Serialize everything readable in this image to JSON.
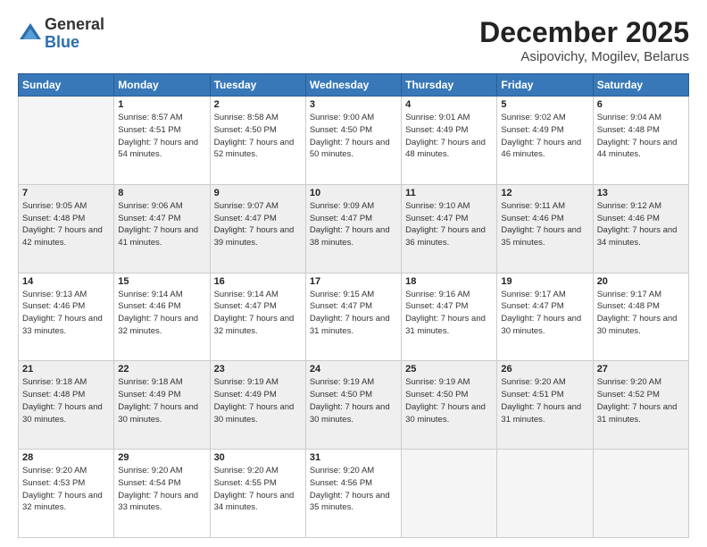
{
  "logo": {
    "general": "General",
    "blue": "Blue"
  },
  "header": {
    "month": "December 2025",
    "location": "Asipovichy, Mogilev, Belarus"
  },
  "weekdays": [
    "Sunday",
    "Monday",
    "Tuesday",
    "Wednesday",
    "Thursday",
    "Friday",
    "Saturday"
  ],
  "weeks": [
    [
      {
        "day": "",
        "empty": true
      },
      {
        "day": "1",
        "sunrise": "Sunrise: 8:57 AM",
        "sunset": "Sunset: 4:51 PM",
        "daylight": "Daylight: 7 hours and 54 minutes."
      },
      {
        "day": "2",
        "sunrise": "Sunrise: 8:58 AM",
        "sunset": "Sunset: 4:50 PM",
        "daylight": "Daylight: 7 hours and 52 minutes."
      },
      {
        "day": "3",
        "sunrise": "Sunrise: 9:00 AM",
        "sunset": "Sunset: 4:50 PM",
        "daylight": "Daylight: 7 hours and 50 minutes."
      },
      {
        "day": "4",
        "sunrise": "Sunrise: 9:01 AM",
        "sunset": "Sunset: 4:49 PM",
        "daylight": "Daylight: 7 hours and 48 minutes."
      },
      {
        "day": "5",
        "sunrise": "Sunrise: 9:02 AM",
        "sunset": "Sunset: 4:49 PM",
        "daylight": "Daylight: 7 hours and 46 minutes."
      },
      {
        "day": "6",
        "sunrise": "Sunrise: 9:04 AM",
        "sunset": "Sunset: 4:48 PM",
        "daylight": "Daylight: 7 hours and 44 minutes."
      }
    ],
    [
      {
        "day": "7",
        "sunrise": "Sunrise: 9:05 AM",
        "sunset": "Sunset: 4:48 PM",
        "daylight": "Daylight: 7 hours and 42 minutes."
      },
      {
        "day": "8",
        "sunrise": "Sunrise: 9:06 AM",
        "sunset": "Sunset: 4:47 PM",
        "daylight": "Daylight: 7 hours and 41 minutes."
      },
      {
        "day": "9",
        "sunrise": "Sunrise: 9:07 AM",
        "sunset": "Sunset: 4:47 PM",
        "daylight": "Daylight: 7 hours and 39 minutes."
      },
      {
        "day": "10",
        "sunrise": "Sunrise: 9:09 AM",
        "sunset": "Sunset: 4:47 PM",
        "daylight": "Daylight: 7 hours and 38 minutes."
      },
      {
        "day": "11",
        "sunrise": "Sunrise: 9:10 AM",
        "sunset": "Sunset: 4:47 PM",
        "daylight": "Daylight: 7 hours and 36 minutes."
      },
      {
        "day": "12",
        "sunrise": "Sunrise: 9:11 AM",
        "sunset": "Sunset: 4:46 PM",
        "daylight": "Daylight: 7 hours and 35 minutes."
      },
      {
        "day": "13",
        "sunrise": "Sunrise: 9:12 AM",
        "sunset": "Sunset: 4:46 PM",
        "daylight": "Daylight: 7 hours and 34 minutes."
      }
    ],
    [
      {
        "day": "14",
        "sunrise": "Sunrise: 9:13 AM",
        "sunset": "Sunset: 4:46 PM",
        "daylight": "Daylight: 7 hours and 33 minutes."
      },
      {
        "day": "15",
        "sunrise": "Sunrise: 9:14 AM",
        "sunset": "Sunset: 4:46 PM",
        "daylight": "Daylight: 7 hours and 32 minutes."
      },
      {
        "day": "16",
        "sunrise": "Sunrise: 9:14 AM",
        "sunset": "Sunset: 4:47 PM",
        "daylight": "Daylight: 7 hours and 32 minutes."
      },
      {
        "day": "17",
        "sunrise": "Sunrise: 9:15 AM",
        "sunset": "Sunset: 4:47 PM",
        "daylight": "Daylight: 7 hours and 31 minutes."
      },
      {
        "day": "18",
        "sunrise": "Sunrise: 9:16 AM",
        "sunset": "Sunset: 4:47 PM",
        "daylight": "Daylight: 7 hours and 31 minutes."
      },
      {
        "day": "19",
        "sunrise": "Sunrise: 9:17 AM",
        "sunset": "Sunset: 4:47 PM",
        "daylight": "Daylight: 7 hours and 30 minutes."
      },
      {
        "day": "20",
        "sunrise": "Sunrise: 9:17 AM",
        "sunset": "Sunset: 4:48 PM",
        "daylight": "Daylight: 7 hours and 30 minutes."
      }
    ],
    [
      {
        "day": "21",
        "sunrise": "Sunrise: 9:18 AM",
        "sunset": "Sunset: 4:48 PM",
        "daylight": "Daylight: 7 hours and 30 minutes."
      },
      {
        "day": "22",
        "sunrise": "Sunrise: 9:18 AM",
        "sunset": "Sunset: 4:49 PM",
        "daylight": "Daylight: 7 hours and 30 minutes."
      },
      {
        "day": "23",
        "sunrise": "Sunrise: 9:19 AM",
        "sunset": "Sunset: 4:49 PM",
        "daylight": "Daylight: 7 hours and 30 minutes."
      },
      {
        "day": "24",
        "sunrise": "Sunrise: 9:19 AM",
        "sunset": "Sunset: 4:50 PM",
        "daylight": "Daylight: 7 hours and 30 minutes."
      },
      {
        "day": "25",
        "sunrise": "Sunrise: 9:19 AM",
        "sunset": "Sunset: 4:50 PM",
        "daylight": "Daylight: 7 hours and 30 minutes."
      },
      {
        "day": "26",
        "sunrise": "Sunrise: 9:20 AM",
        "sunset": "Sunset: 4:51 PM",
        "daylight": "Daylight: 7 hours and 31 minutes."
      },
      {
        "day": "27",
        "sunrise": "Sunrise: 9:20 AM",
        "sunset": "Sunset: 4:52 PM",
        "daylight": "Daylight: 7 hours and 31 minutes."
      }
    ],
    [
      {
        "day": "28",
        "sunrise": "Sunrise: 9:20 AM",
        "sunset": "Sunset: 4:53 PM",
        "daylight": "Daylight: 7 hours and 32 minutes."
      },
      {
        "day": "29",
        "sunrise": "Sunrise: 9:20 AM",
        "sunset": "Sunset: 4:54 PM",
        "daylight": "Daylight: 7 hours and 33 minutes."
      },
      {
        "day": "30",
        "sunrise": "Sunrise: 9:20 AM",
        "sunset": "Sunset: 4:55 PM",
        "daylight": "Daylight: 7 hours and 34 minutes."
      },
      {
        "day": "31",
        "sunrise": "Sunrise: 9:20 AM",
        "sunset": "Sunset: 4:56 PM",
        "daylight": "Daylight: 7 hours and 35 minutes."
      },
      {
        "day": "",
        "empty": true
      },
      {
        "day": "",
        "empty": true
      },
      {
        "day": "",
        "empty": true
      }
    ]
  ]
}
